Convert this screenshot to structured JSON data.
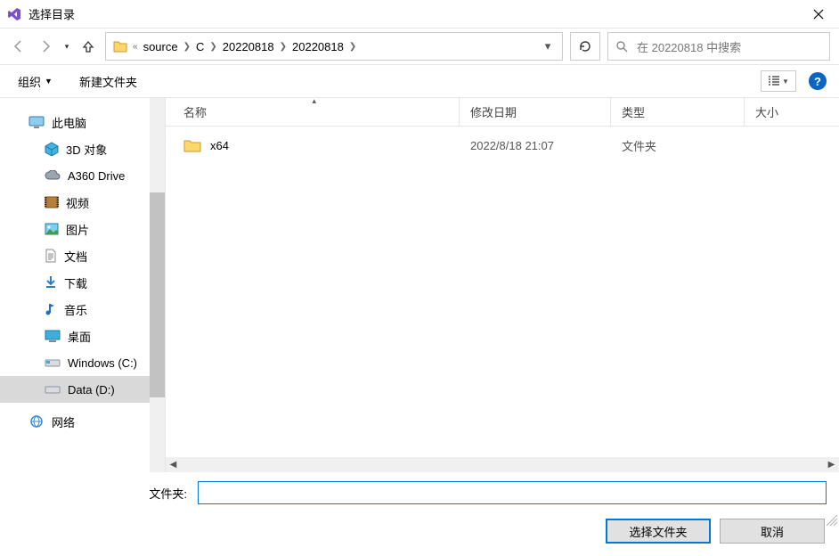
{
  "title": "选择目录",
  "breadcrumbs": {
    "sep0": "«",
    "items": [
      "source",
      "C",
      "20220818",
      "20220818"
    ]
  },
  "search": {
    "placeholder": "在 20220818 中搜索"
  },
  "toolbar": {
    "organize": "组织",
    "newfolder": "新建文件夹"
  },
  "columns": {
    "name": "名称",
    "date": "修改日期",
    "type": "类型",
    "size": "大小"
  },
  "sidebar": {
    "thispc": "此电脑",
    "items": [
      {
        "label": "3D 对象"
      },
      {
        "label": "A360 Drive"
      },
      {
        "label": "视频"
      },
      {
        "label": "图片"
      },
      {
        "label": "文档"
      },
      {
        "label": "下载"
      },
      {
        "label": "音乐"
      },
      {
        "label": "桌面"
      },
      {
        "label": "Windows (C:)"
      },
      {
        "label": "Data (D:)"
      },
      {
        "label": "网络"
      }
    ]
  },
  "rows": [
    {
      "name": "x64",
      "date": "2022/8/18 21:07",
      "type": "文件夹"
    }
  ],
  "footer": {
    "folderlabel": "文件夹:",
    "foldervalue": "",
    "select": "选择文件夹",
    "cancel": "取消"
  }
}
